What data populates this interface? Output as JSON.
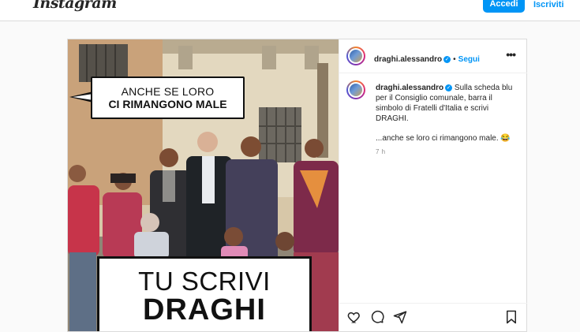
{
  "nav": {
    "logo": "Instagram",
    "login_label": "Accedi",
    "signup_label": "Iscriviti"
  },
  "post": {
    "image": {
      "bubble_line1": "ANCHE SE LORO",
      "bubble_line2": "CI RIMANGONO MALE",
      "box_line1": "TU SCRIVI",
      "box_line2": "DRAGHI"
    },
    "header": {
      "username": "draghi.alessandro",
      "separator": "•",
      "follow_label": "Segui",
      "more": "•••"
    },
    "caption": {
      "username": "draghi.alessandro",
      "text1": "Sulla scheda blu per il Consiglio comunale, barra il simbolo di Fratelli d'Italia e scrivi DRAGHI.",
      "text2": "...anche se loro ci rimangono male. 😂",
      "time": "7 h"
    },
    "actions": [
      "heart-icon",
      "comment-icon",
      "share-icon",
      "bookmark-icon"
    ]
  },
  "colors": {
    "accent": "#0095f6",
    "border": "#dbdbdb",
    "text": "#262626",
    "muted": "#8e8e8e"
  }
}
